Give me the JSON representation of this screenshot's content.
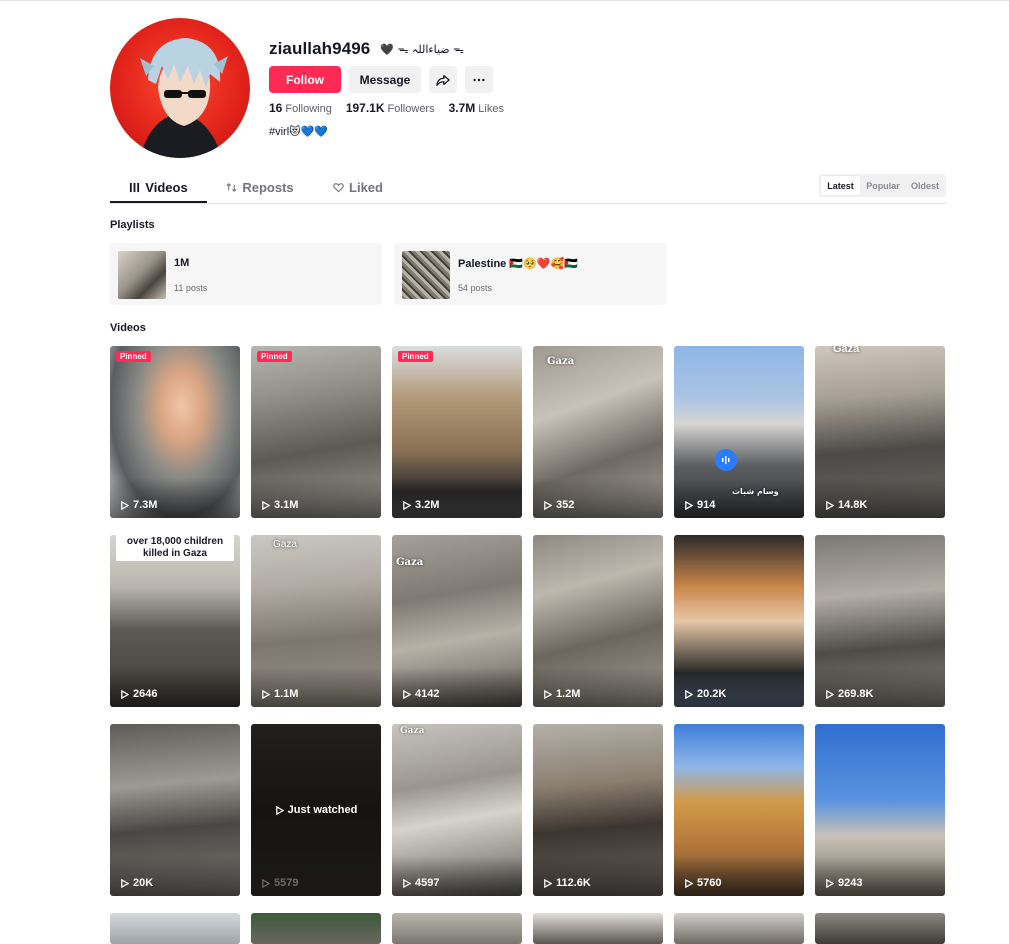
{
  "profile": {
    "username": "ziaullah9496",
    "nickname": "🖤 ᯓ ضیاءاللہ ᯓ",
    "follow_label": "Follow",
    "message_label": "Message",
    "stats": {
      "following_count": "16",
      "following_label": "Following",
      "followers_count": "197.1K",
      "followers_label": "Followers",
      "likes_count": "3.7M",
      "likes_label": "Likes"
    },
    "bio": "#virl😻💙💙"
  },
  "tabs": [
    {
      "label": "Videos",
      "icon": "grid-icon",
      "active": true
    },
    {
      "label": "Reposts",
      "icon": "repost-icon",
      "active": false
    },
    {
      "label": "Liked",
      "icon": "heart-outline-icon",
      "active": false
    }
  ],
  "sort": {
    "options": [
      "Latest",
      "Popular",
      "Oldest"
    ],
    "selected": "Latest"
  },
  "playlists": {
    "title": "Playlists",
    "items": [
      {
        "name": "1M",
        "count": "11 posts"
      },
      {
        "name": "Palestine 🇵🇸🥺❤️🥰🇵🇸",
        "count": "54 posts"
      }
    ]
  },
  "videos": {
    "title": "Videos",
    "pinned_label": "Pinned",
    "just_watched_label": "Just watched",
    "items": [
      {
        "views": "7.3M",
        "pinned": true
      },
      {
        "views": "3.1M",
        "pinned": true
      },
      {
        "views": "3.2M",
        "pinned": true
      },
      {
        "views": "352",
        "overlay": "Gaza"
      },
      {
        "views": "914",
        "overlay": "وسام شبات",
        "audio": true
      },
      {
        "views": "14.8K",
        "overlay": "Gaza"
      },
      {
        "views": "2646",
        "caption": "over 18,000 children killed in Gaza"
      },
      {
        "views": "1.1M",
        "overlay": "Gaza"
      },
      {
        "views": "4142",
        "overlay": "Gaza"
      },
      {
        "views": "1.2M"
      },
      {
        "views": "20.2K"
      },
      {
        "views": "269.8K"
      },
      {
        "views": "20K"
      },
      {
        "views": "5579",
        "just_watched": true
      },
      {
        "views": "4597",
        "overlay": "Gaza"
      },
      {
        "views": "112.6K"
      },
      {
        "views": "5760"
      },
      {
        "views": "9243"
      }
    ]
  },
  "colors": {
    "accent": "#fe2c55",
    "text_primary": "#161823",
    "text_secondary": "#73747b",
    "button_secondary_bg": "#f1f1f2",
    "audio_badge": "#2b7cff"
  }
}
